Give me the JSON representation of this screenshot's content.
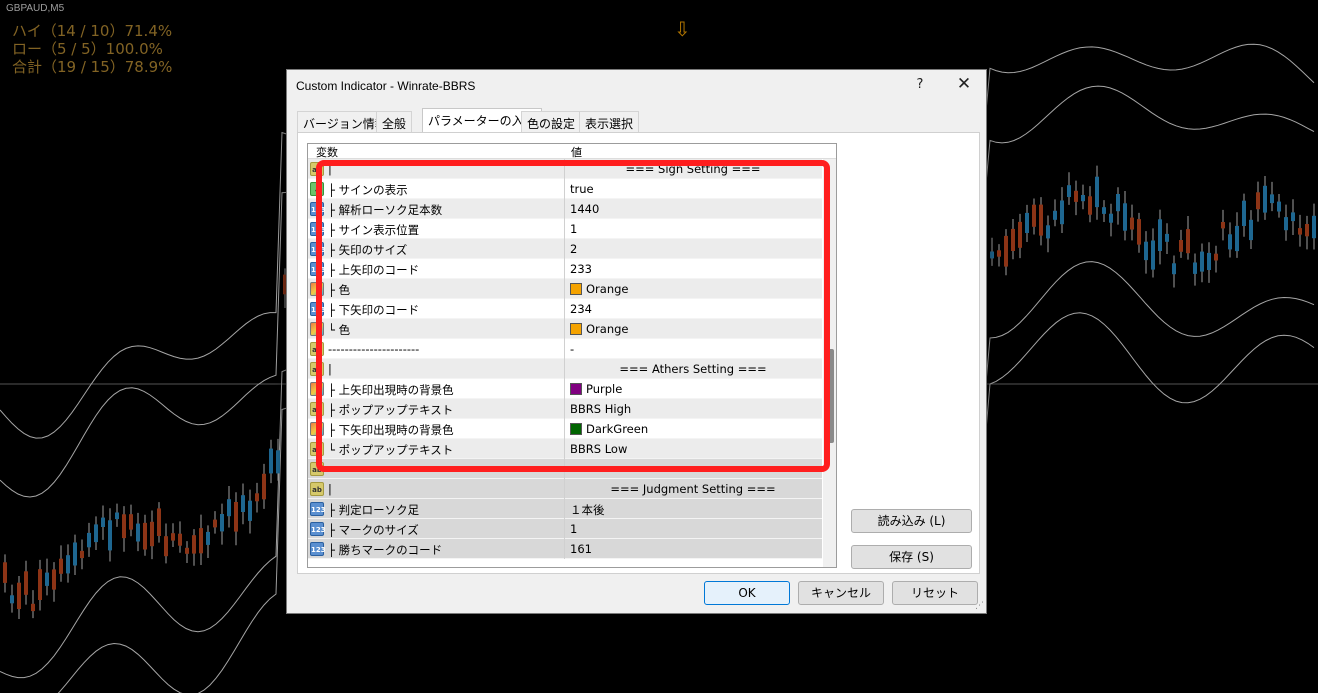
{
  "chart": {
    "symbol": "GBPAUD,M5",
    "stats": [
      "ハイ（14 / 10）71.4%",
      "ロー（5 / 5）100.0%",
      "合計（19 / 15）78.9%"
    ]
  },
  "dialog": {
    "title": "Custom Indicator - Winrate-BBRS",
    "help": "?",
    "close": "✕",
    "tabs": [
      "バージョン情報",
      "全般",
      "パラメーターの入力",
      "色の設定",
      "表示選択"
    ],
    "active_tab": 2,
    "grid": {
      "col_variable": "変数",
      "col_value": "値",
      "rows": [
        {
          "icon": "ab",
          "name": "|",
          "value": "=== Sign Setting ===",
          "center": true
        },
        {
          "icon": "bool",
          "name": "├ サインの表示",
          "value": "true"
        },
        {
          "icon": "num",
          "name": "├ 解析ローソク足本数",
          "value": "1440"
        },
        {
          "icon": "num",
          "name": "├ サイン表示位置",
          "value": "1"
        },
        {
          "icon": "num",
          "name": "├ 矢印のサイズ",
          "value": "2"
        },
        {
          "icon": "num",
          "name": "├ 上矢印のコード",
          "value": "233"
        },
        {
          "icon": "col",
          "name": "├ 色",
          "value": "Orange",
          "swatch": "#f5a300"
        },
        {
          "icon": "num",
          "name": "├ 下矢印のコード",
          "value": "234"
        },
        {
          "icon": "col",
          "name": "└ 色",
          "value": "Orange",
          "swatch": "#f5a300"
        },
        {
          "icon": "ab",
          "name": "----------------------",
          "value": "-"
        },
        {
          "icon": "ab",
          "name": "|",
          "value": "=== Athers Setting ===",
          "center": true
        },
        {
          "icon": "col",
          "name": "├ 上矢印出現時の背景色",
          "value": "Purple",
          "swatch": "#800080"
        },
        {
          "icon": "ab",
          "name": "├ ポップアップテキスト",
          "value": "BBRS High"
        },
        {
          "icon": "col",
          "name": "├ 下矢印出現時の背景色",
          "value": "DarkGreen",
          "swatch": "#006400"
        },
        {
          "icon": "ab",
          "name": "└ ポップアップテキスト",
          "value": "BBRS Low"
        },
        {
          "icon": "ab",
          "name": "----------------------",
          "value": "-"
        },
        {
          "icon": "ab",
          "name": "|",
          "value": "=== Judgment Setting ===",
          "center": true
        },
        {
          "icon": "num",
          "name": "├ 判定ローソク足",
          "value": "１本後"
        },
        {
          "icon": "num",
          "name": "├ マークのサイズ",
          "value": "1"
        },
        {
          "icon": "num",
          "name": "├ 勝ちマークのコード",
          "value": "161"
        }
      ]
    },
    "buttons": {
      "load": "読み込み (L)",
      "save": "保存 (S)",
      "ok": "OK",
      "cancel": "キャンセル",
      "reset": "リセット"
    }
  },
  "colors": {
    "bull": "#2a8fc9",
    "bear": "#c4481f",
    "band": "#e6e6e6",
    "highlight": "#ff1e1e"
  }
}
